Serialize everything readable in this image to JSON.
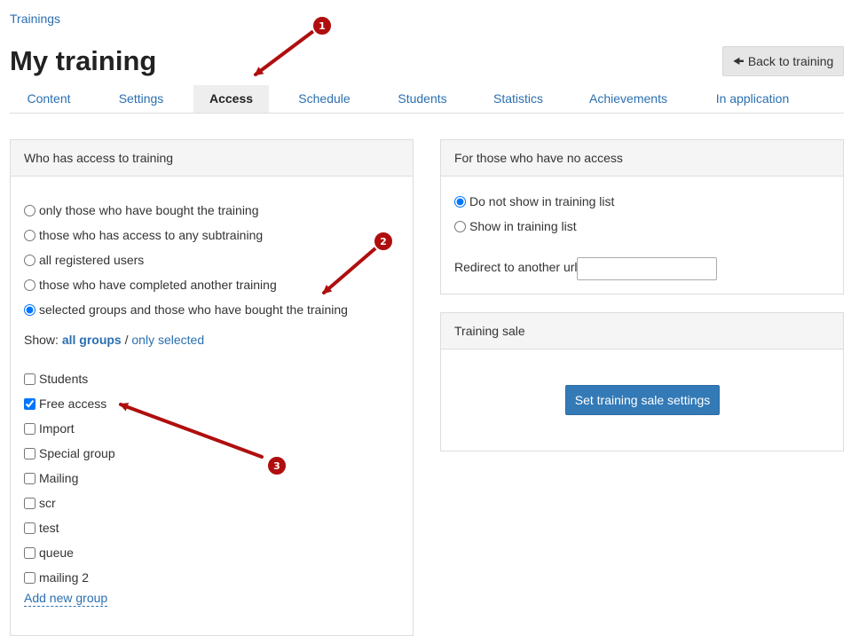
{
  "breadcrumb": "Trainings",
  "page_title": "My training",
  "back_button": {
    "icon": "arrow-left-icon",
    "label": "Back to training"
  },
  "tabs": [
    {
      "label": "Content",
      "active": false
    },
    {
      "label": "Settings",
      "active": false
    },
    {
      "label": "Access",
      "active": true
    },
    {
      "label": "Schedule",
      "active": false
    },
    {
      "label": "Students",
      "active": false
    },
    {
      "label": "Statistics",
      "active": false
    },
    {
      "label": "Achievements",
      "active": false
    },
    {
      "label": "In application",
      "active": false
    }
  ],
  "access_panel": {
    "title": "Who has access to training",
    "options": [
      {
        "label": "only those who have bought the training",
        "selected": false
      },
      {
        "label": "those who has access to any subtraining",
        "selected": false
      },
      {
        "label": "all registered users",
        "selected": false
      },
      {
        "label": "those who have completed another training",
        "selected": false
      },
      {
        "label": "selected groups and those who have bought the training",
        "selected": true
      }
    ],
    "show_label": "Show:",
    "show_all": "all groups",
    "show_sep": "/",
    "show_selected": "only selected",
    "groups": [
      {
        "label": "Students",
        "checked": false
      },
      {
        "label": "Free access",
        "checked": true
      },
      {
        "label": "Import",
        "checked": false
      },
      {
        "label": "Special group",
        "checked": false
      },
      {
        "label": "Mailing",
        "checked": false
      },
      {
        "label": "scr",
        "checked": false
      },
      {
        "label": "test",
        "checked": false
      },
      {
        "label": "queue",
        "checked": false
      },
      {
        "label": "mailing 2",
        "checked": false
      }
    ],
    "add_group": "Add new group"
  },
  "no_access_panel": {
    "title": "For those who have no access",
    "options": [
      {
        "label": "Do not show in training list",
        "selected": true
      },
      {
        "label": "Show in training list",
        "selected": false
      }
    ],
    "redirect_label": "Redirect to another url",
    "redirect_value": ""
  },
  "sale_panel": {
    "title": "Training sale",
    "button": "Set training sale settings"
  },
  "annotations": [
    {
      "number": "1"
    },
    {
      "number": "2"
    },
    {
      "number": "3"
    }
  ],
  "colors": {
    "link": "#2a6fb0",
    "primary_button": "#337ab7",
    "annotation": "#b00e0e"
  }
}
